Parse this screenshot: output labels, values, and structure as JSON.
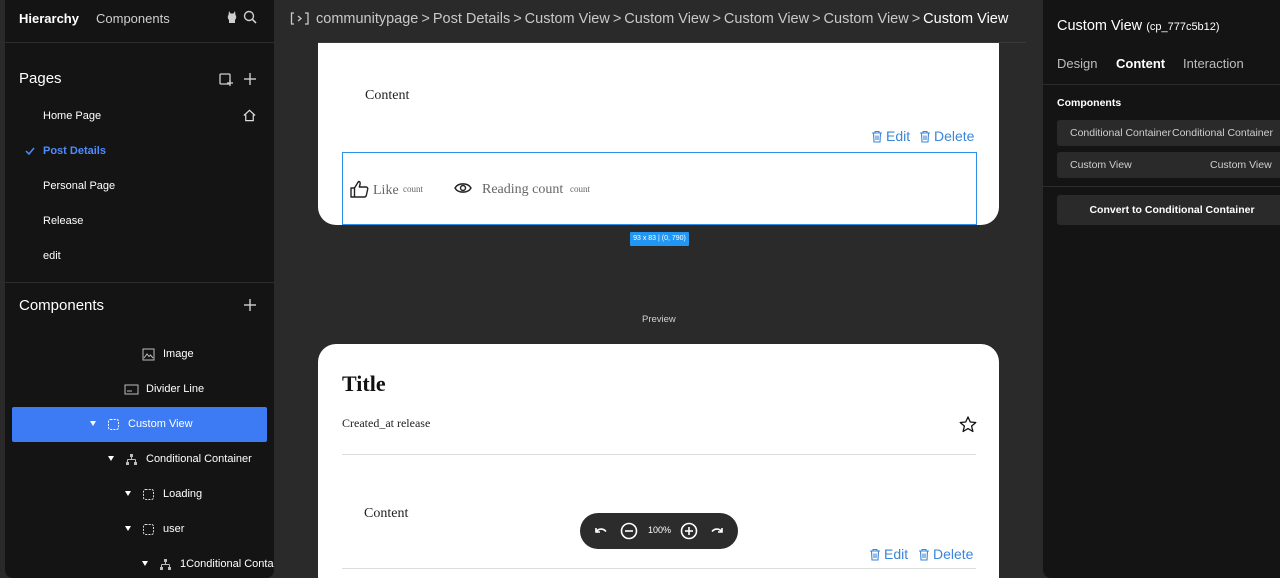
{
  "left_panel": {
    "tabs": [
      "Hierarchy",
      "Components"
    ],
    "pages_title": "Pages",
    "pages": [
      {
        "label": "Home Page",
        "home": true
      },
      {
        "label": "Post Details",
        "active": true
      },
      {
        "label": "Personal Page"
      },
      {
        "label": "Release"
      },
      {
        "label": "edit"
      }
    ],
    "components_title": "Components",
    "tree": [
      {
        "label": "Image",
        "icon": "image-icon"
      },
      {
        "label": "Divider Line",
        "icon": "divider-icon"
      },
      {
        "label": "Custom View",
        "icon": "custom-view-icon",
        "active": true,
        "expanded": true
      },
      {
        "label": "Conditional Container",
        "icon": "hierarchy-icon",
        "expanded": true
      },
      {
        "label": "Loading",
        "icon": "custom-view-icon",
        "expanded": true
      },
      {
        "label": "user",
        "icon": "custom-view-icon",
        "expanded": true
      },
      {
        "label": "1Conditional Conta",
        "icon": "hierarchy-icon",
        "expanded": true
      }
    ]
  },
  "breadcrumb": [
    "communitypage",
    "Post Details",
    "Custom View",
    "Custom View",
    "Custom View",
    "Custom View",
    "Custom View"
  ],
  "canvas": {
    "card1": {
      "content_label": "Content",
      "edit_label": "Edit",
      "delete_label": "Delete",
      "like_label": "Like",
      "like_count": "count",
      "reading_label": "Reading count",
      "reading_count": "count"
    },
    "size_tag": "93 x 83 | (0, 790)",
    "preview_label": "Preview",
    "card2": {
      "title": "Title",
      "created": "Created_at release",
      "content_label": "Content",
      "edit_label": "Edit",
      "delete_label": "Delete"
    },
    "zoom": {
      "value": "100%"
    }
  },
  "right_panel": {
    "title": "Custom View",
    "id": "(cp_777c5b12)",
    "tabs": [
      "Design",
      "Content",
      "Interaction"
    ],
    "active_tab": "Content",
    "section": "Components",
    "rows": [
      {
        "left": "Conditional Container",
        "right": "Conditional Container"
      },
      {
        "left": "Custom View",
        "right": "Custom View"
      }
    ],
    "convert_button": "Convert to Conditional Container"
  },
  "colors": {
    "accent": "#3d7bf5",
    "link": "#3a86d8",
    "panel": "#141414",
    "canvas_bg": "#2a2a2a"
  }
}
